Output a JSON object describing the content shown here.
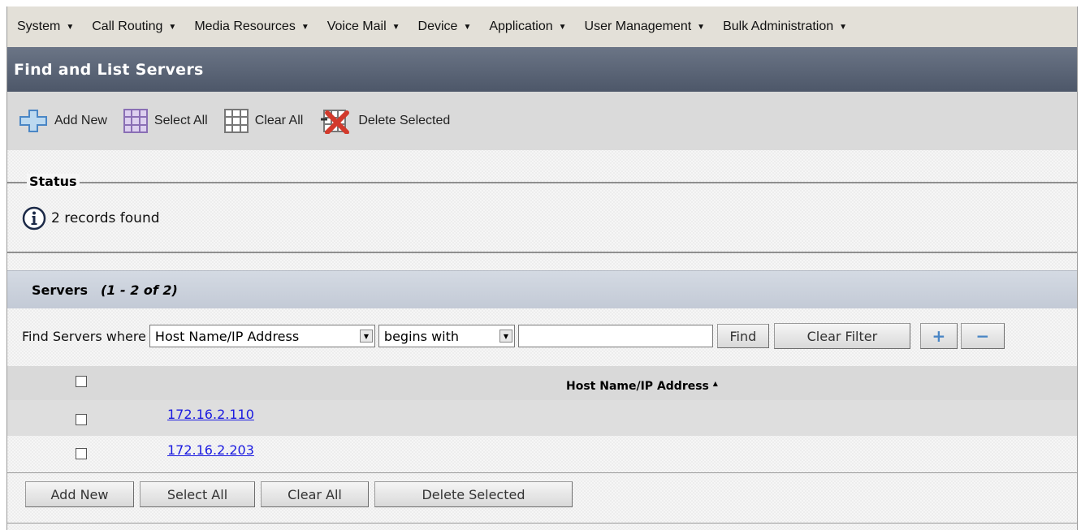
{
  "menu": [
    "System",
    "Call Routing",
    "Media Resources",
    "Voice Mail",
    "Device",
    "Application",
    "User Management",
    "Bulk Administration"
  ],
  "page_title": "Find and List Servers",
  "toolbar": {
    "add_new": "Add New",
    "select_all": "Select All",
    "clear_all": "Clear All",
    "delete_selected": "Delete Selected"
  },
  "status": {
    "legend": "Status",
    "message": "2 records found"
  },
  "servers": {
    "title": "Servers",
    "count": "(1 - 2 of 2)",
    "find_label": "Find Servers where",
    "field_select": "Host Name/IP Address",
    "operator_select": "begins with",
    "search_value": "",
    "find_button": "Find",
    "clear_filter_button": "Clear Filter",
    "plus_button": "+",
    "minus_button": "−",
    "column_header": "Host Name/IP Address",
    "sort_indicator": "▲",
    "rows": [
      "172.16.2.110",
      "172.16.2.203"
    ]
  },
  "bottom_buttons": {
    "add_new": "Add New",
    "select_all": "Select All",
    "clear_all": "Clear All",
    "delete_selected": "Delete Selected"
  },
  "colors": {
    "title_bar": "#5d6677",
    "section_header": "#c9d0db",
    "link": "#1a1ae0"
  }
}
